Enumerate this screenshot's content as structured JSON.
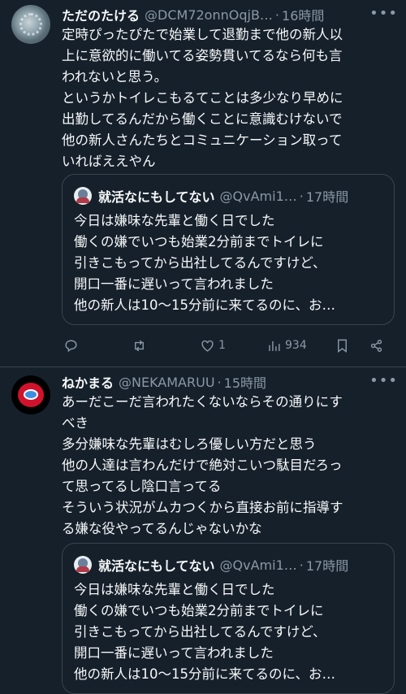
{
  "tweets": [
    {
      "name": "ただのたける",
      "handle": "@DCM72onnOqjB…",
      "time": "16時間",
      "text": [
        "定時ぴったぴたで始業して退勤まで他の新人以",
        "上に意欲的に働いてる姿勢貫いてるなら何も言",
        "われないと思う。",
        "というかトイレこもるてことは多少なり早めに",
        "出勤してるんだから働くことに意識むけないで",
        "他の新人さんたちとコミュニケーション取って",
        "いればええやん"
      ],
      "quote": {
        "name": "就活なにもしてない",
        "handle": "@QvAmi1…",
        "time": "17時間",
        "text": [
          "今日は嫌味な先輩と働く日でした",
          "働くの嫌でいつも始業2分前までトイレに",
          "引きこもってから出社してるんですけど、",
          "開口一番に遅いって言われました",
          "他の新人は10〜15分前に来てるのに、お…"
        ]
      },
      "actions": {
        "likes": "1",
        "views": "934"
      }
    },
    {
      "name": "ねかまる",
      "handle": "@NEKAMARUU",
      "time": "15時間",
      "text": [
        "あーだこーだ言われたくないならその通りにす",
        "べき",
        "多分嫌味な先輩はむしろ優しい方だと思う",
        "他の人達は言わんだけで絶対こいつ駄目だろっ",
        "て思ってるし陰口言ってる",
        "そういう状況がムカつくから直接お前に指導す",
        "る嫌な役やってるんじゃないかな"
      ],
      "quote": {
        "name": "就活なにもしてない",
        "handle": "@QvAmi1…",
        "time": "17時間",
        "text": [
          "今日は嫌味な先輩と働く日でした",
          "働くの嫌でいつも始業2分前までトイレに",
          "引きこもってから出社してるんですけど、",
          "開口一番に遅いって言われました",
          "他の新人は10〜15分前に来てるのに、お…"
        ]
      }
    }
  ],
  "dot": "·",
  "more": "•••",
  "icons": [
    "reply-icon",
    "retweet-icon",
    "like-icon",
    "views-icon",
    "bookmark-icon",
    "share-icon"
  ],
  "colors": {
    "background": "#15202b",
    "secondary_text": "#8b98a5",
    "border": "#38444d"
  }
}
